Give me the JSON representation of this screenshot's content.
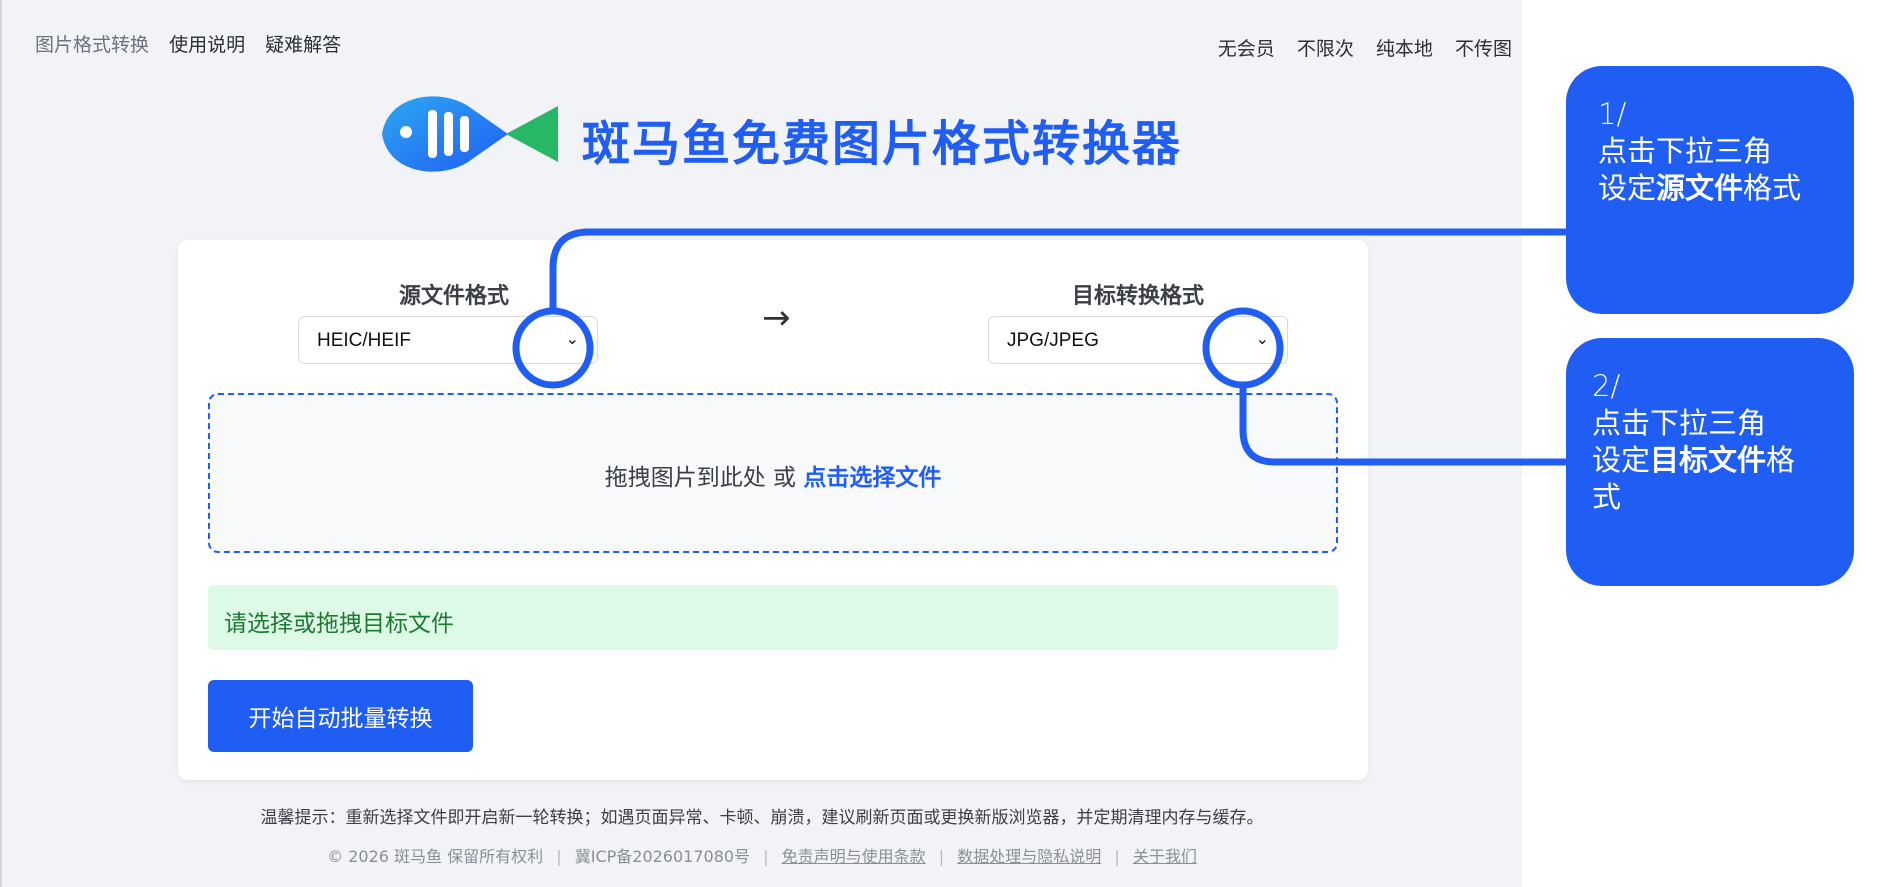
{
  "nav": {
    "items": [
      "图片格式转换",
      "使用说明",
      "疑难解答"
    ]
  },
  "taglines": [
    "无会员",
    "不限次",
    "纯本地",
    "不传图"
  ],
  "brand": {
    "title": "斑马鱼免费图片格式转换器",
    "color": "#1f5df3"
  },
  "converter": {
    "source_label": "源文件格式",
    "source_value": "HEIC/HEIF",
    "arrow": "→",
    "target_label": "目标转换格式",
    "target_value": "JPG/JPEG",
    "chevron": "⌄",
    "dropzone_text": "拖拽图片到此处 或 ",
    "dropzone_link": "点击选择文件",
    "status": "请选择或拖拽目标文件",
    "start_button": "开始自动批量转换"
  },
  "tip": "温馨提示：重新选择文件即开启新一轮转换；如遇页面异常、卡顿、崩溃，建议刷新页面或更换新版浏览器，并定期清理内存与缓存。",
  "footer": {
    "copyright": "© 2026 斑马鱼 保留所有权利",
    "icp": "冀ICP备2026017080号",
    "links": [
      "免责声明与使用条款",
      "数据处理与隐私说明",
      "关于我们"
    ],
    "separator": "|"
  },
  "callouts": [
    {
      "step": "1/",
      "line1": "点击下拉三角",
      "prefix": "设定",
      "bold": "源文件",
      "suffix": "格式"
    },
    {
      "step": "2/",
      "line1": "点击下拉三角",
      "prefix": "设定",
      "bold": "目标文件",
      "suffix": "格式"
    }
  ],
  "colors": {
    "accent": "#1f5df3",
    "background": "#f1f3f6",
    "success_bg": "#dcfae6",
    "success_text": "#1e7a33"
  }
}
